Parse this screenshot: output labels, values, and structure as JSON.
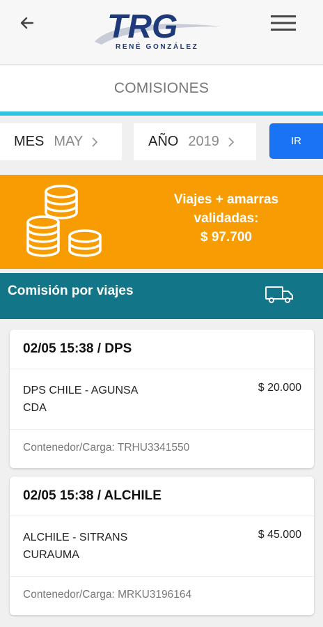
{
  "header": {
    "logo_text": "TRG",
    "logo_subtitle": "RENÉ GONZÁLEZ"
  },
  "page": {
    "title": "COMISIONES"
  },
  "filters": {
    "month_label": "MES",
    "month_value": "MAY",
    "year_label": "AÑO",
    "year_value": "2019",
    "go_label": "IR"
  },
  "summary": {
    "line1": "Viajes + amarras",
    "line2": "validadas:",
    "amount": "$ 97.700"
  },
  "section": {
    "title": "Comisión por viajes"
  },
  "trips": [
    {
      "header": "02/05 15:38 / DPS",
      "name": "DPS CHILE - AGUNSA CDA",
      "amount": "$ 20.000",
      "container": "Contenedor/Carga: TRHU3341550"
    },
    {
      "header": "02/05 15:38 / ALCHILE",
      "name": "ALCHILE - SITRANS CURAUMA",
      "amount": "$ 45.000",
      "container": "Contenedor/Carga: MRKU3196164"
    }
  ],
  "colors": {
    "accent": "#2fc3dd",
    "button": "#1a73f5",
    "summary_bg": "#f89c04",
    "section_bg": "#137588",
    "logo": "#1e3a7b"
  },
  "icons": {
    "back": "arrow-left-icon",
    "menu": "hamburger-menu-icon",
    "chevron": "chevron-right-icon",
    "coins": "coins-stack-icon",
    "truck": "delivery-truck-icon"
  }
}
